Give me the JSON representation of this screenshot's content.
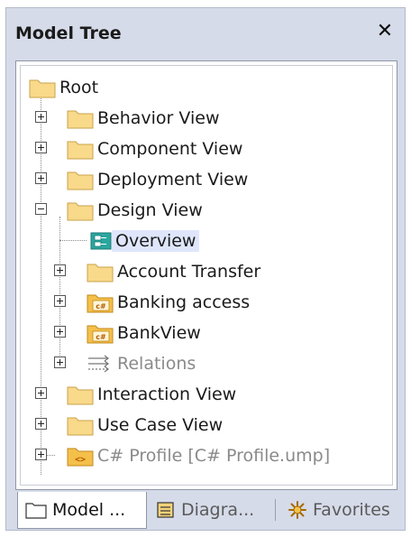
{
  "panel": {
    "title": "Model Tree",
    "close_glyph": "✕"
  },
  "tree": {
    "root": "Root",
    "behavior_view": "Behavior View",
    "component_view": "Component View",
    "deployment_view": "Deployment View",
    "design_view": "Design View",
    "overview": "Overview",
    "account_transfer": "Account Transfer",
    "banking_access": "Banking access",
    "bankview": "BankView",
    "relations": "Relations",
    "interaction_view": "Interaction View",
    "use_case_view": "Use Case View",
    "csharp_profile": "C# Profile [C# Profile.ump]"
  },
  "tabs": {
    "model": "Model ...",
    "diagrams": "Diagra...",
    "favorites": "Favorites"
  },
  "colors": {
    "folder": "#f9d98a",
    "folder_border": "#c9a24a",
    "selection": "#dfe6fb",
    "titlebar": "#d6dbe9",
    "overview_icon": "#2aa7a0"
  },
  "icons": {
    "folder": "folder-icon",
    "csharp_namespace": "csharp-namespace-icon",
    "overview_diagram": "overview-diagram-icon",
    "relations": "relations-icon",
    "profile": "profile-icon",
    "diagrams_tab": "diagram-list-icon",
    "favorites_tab": "favorites-icon",
    "model_tab": "folder-icon",
    "expand": "expand-plus-icon",
    "collapse": "collapse-minus-icon"
  }
}
